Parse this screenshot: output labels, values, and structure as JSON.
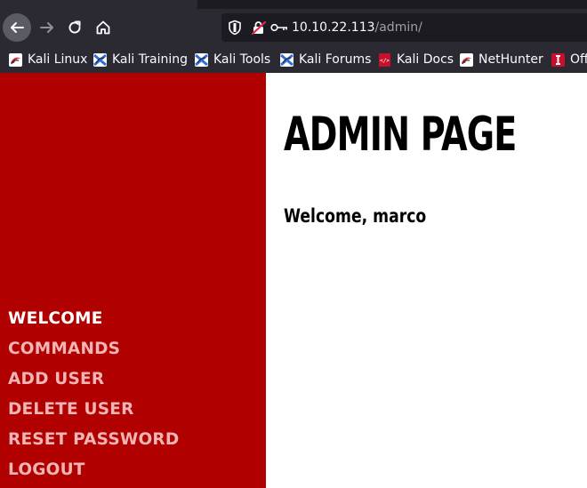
{
  "browser": {
    "url_host": "10.10.22.113",
    "url_path": "/admin/",
    "bookmarks": [
      {
        "label": "Kali Linux",
        "icon": "kali-dragon-icon"
      },
      {
        "label": "Kali Training",
        "icon": "kali-training-icon"
      },
      {
        "label": "Kali Tools",
        "icon": "kali-tools-icon"
      },
      {
        "label": "Kali Forums",
        "icon": "kali-forums-icon"
      },
      {
        "label": "Kali Docs",
        "icon": "kali-docs-icon"
      },
      {
        "label": "NetHunter",
        "icon": "nethunter-icon"
      },
      {
        "label": "Off",
        "icon": "offsec-icon"
      }
    ]
  },
  "sidebar": {
    "items": [
      {
        "label": "WELCOME",
        "active": true
      },
      {
        "label": "COMMANDS",
        "active": false
      },
      {
        "label": "ADD USER",
        "active": false
      },
      {
        "label": "DELETE USER",
        "active": false
      },
      {
        "label": "RESET PASSWORD",
        "active": false
      },
      {
        "label": "LOGOUT",
        "active": false
      }
    ]
  },
  "main": {
    "title": "ADMIN PAGE",
    "welcome_text": "Welcome, marco"
  },
  "colors": {
    "sidebar_bg": "#b00000",
    "nav_active": "#ffffff",
    "nav_inactive": "#f2b4b4",
    "chrome_bg": "#2b2a33",
    "urlbar_bg": "#1c1b22"
  }
}
